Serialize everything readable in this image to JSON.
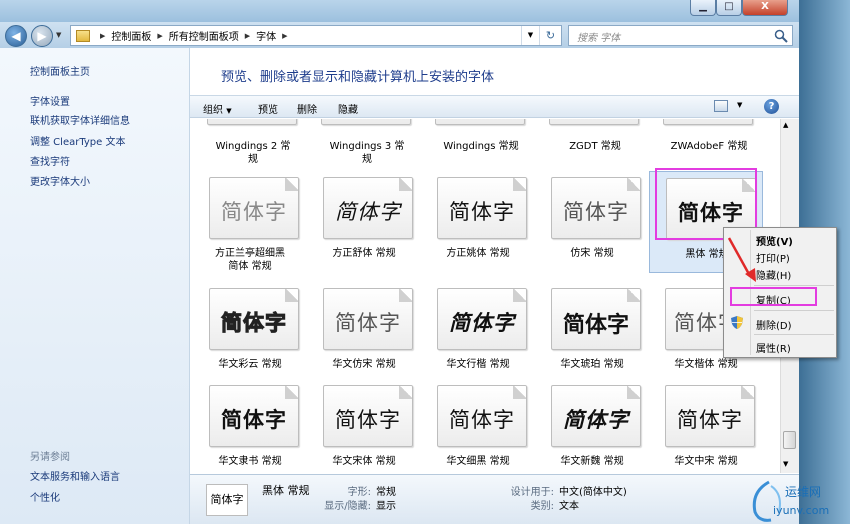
{
  "window": {
    "min_glyph": "▁",
    "max_glyph": "□",
    "close_glyph": "X"
  },
  "address": {
    "crumbs": [
      "控制面板",
      "所有控制面板项",
      "字体"
    ],
    "search_placeholder": "搜索 字体"
  },
  "sidebar": {
    "home": "控制面板主页",
    "links": [
      "字体设置",
      "联机获取字体详细信息",
      "调整 ClearType 文本",
      "查找字符",
      "更改字体大小"
    ],
    "see_also_title": "另请参阅",
    "see_also": [
      "文本服务和输入语言",
      "个性化"
    ]
  },
  "main": {
    "heading": "预览、删除或者显示和隐藏计算机上安装的字体",
    "toolbar": {
      "organize": "组织",
      "preview": "预览",
      "delete": "删除",
      "hide": "隐藏",
      "help": "?"
    }
  },
  "top_row_labels": [
    {
      "line1": "Wingdings 2 常",
      "line2": "规"
    },
    {
      "line1": "Wingdings 3 常",
      "line2": "规"
    },
    {
      "line1": "Wingdings 常规",
      "line2": ""
    },
    {
      "line1": "ZGDT 常规",
      "line2": ""
    },
    {
      "line1": "ZWAdobeF 常规",
      "line2": ""
    }
  ],
  "fonts": [
    {
      "sample": "简体字",
      "line1": "方正兰亭超细黑",
      "line2": "简体 常规"
    },
    {
      "sample": "简体字",
      "line1": "方正舒体 常规",
      "line2": ""
    },
    {
      "sample": "简体字",
      "line1": "方正姚体 常规",
      "line2": ""
    },
    {
      "sample": "简体字",
      "line1": "仿宋 常规",
      "line2": ""
    },
    {
      "sample": "简体字",
      "line1": "黑体 常规",
      "line2": ""
    },
    {
      "sample": "简体字",
      "line1": "华文彩云 常规",
      "line2": ""
    },
    {
      "sample": "简体字",
      "line1": "华文仿宋 常规",
      "line2": ""
    },
    {
      "sample": "简体字",
      "line1": "华文行楷 常规",
      "line2": ""
    },
    {
      "sample": "简体字",
      "line1": "华文琥珀 常规",
      "line2": ""
    },
    {
      "sample": "简体字",
      "line1": "华文楷体 常规",
      "line2": ""
    },
    {
      "sample": "简体字",
      "line1": "华文隶书 常规",
      "line2": ""
    },
    {
      "sample": "简体字",
      "line1": "华文宋体 常规",
      "line2": ""
    },
    {
      "sample": "简体字",
      "line1": "华文细黑 常规",
      "line2": ""
    },
    {
      "sample": "简体字",
      "line1": "华文新魏 常规",
      "line2": ""
    },
    {
      "sample": "简体字",
      "line1": "华文中宋 常规",
      "line2": ""
    }
  ],
  "context_menu": {
    "preview": "预览(V)",
    "print": "打印(P)",
    "hide": "隐藏(H)",
    "copy": "复制(C)",
    "delete": "删除(D)",
    "properties": "属性(R)"
  },
  "details": {
    "thumb": "简体字",
    "name": "黑体 常规",
    "style_label": "字形:",
    "style_value": "常规",
    "visibility_label": "显示/隐藏:",
    "visibility_value": "显示",
    "designed_label": "设计用于:",
    "designed_value": "中文(简体中文)",
    "category_label": "类别:",
    "category_value": "文本"
  },
  "watermark": {
    "line1": "运维网",
    "line2": "iyunv.com"
  },
  "colors": {
    "highlight": "#e33ce0",
    "arrow": "#e02a2a",
    "link": "#1a3a7a",
    "heading": "#1e3d8c"
  }
}
